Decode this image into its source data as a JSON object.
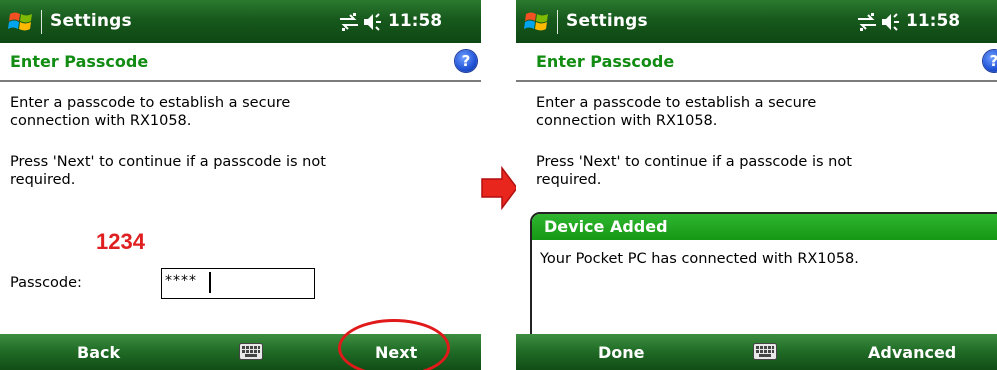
{
  "left_screen": {
    "app_title": "Settings",
    "clock": "11:58",
    "header_title": "Enter Passcode",
    "help_label": "?",
    "paragraph_1": [
      "Enter a passcode to establish a secure",
      "connection with RX1058."
    ],
    "paragraph_2": [
      "Press 'Next' to continue if a passcode is not",
      "required."
    ],
    "annotation": "1234",
    "passcode_label": "Passcode:",
    "passcode_value": "****",
    "softkey_left": "Back",
    "softkey_right": "Next"
  },
  "right_screen": {
    "app_title": "Settings",
    "clock": "11:58",
    "header_title": "Enter Passcode",
    "help_label": "?",
    "paragraph_1": [
      "Enter a passcode to establish a secure",
      "connection with RX1058."
    ],
    "paragraph_2": [
      "Press 'Next' to continue if a passcode is not",
      "required."
    ],
    "notification_title": "Device Added",
    "notification_body": "Your Pocket PC has connected with RX1058.",
    "softkey_left": "Done",
    "softkey_right": "Advanced"
  },
  "colors": {
    "titlebar_green": "#17591c",
    "header_text_green": "#128c12",
    "annotation_red": "#e02020",
    "notification_green": "#169916"
  },
  "icons": [
    "windows-start-icon",
    "connectivity-icon",
    "volume-icon",
    "help-icon",
    "keyboard-icon",
    "flow-arrow-icon"
  ]
}
